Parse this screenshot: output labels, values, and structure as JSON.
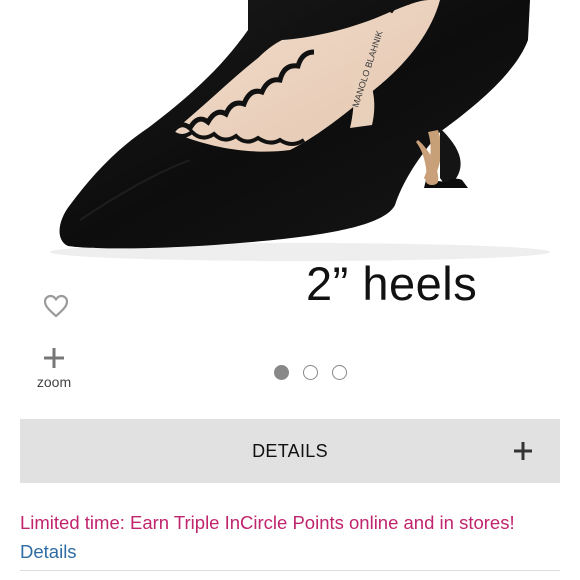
{
  "product": {
    "image_alt": "black suede scalloped kitten-heel pump",
    "overlay_caption": "2” heels"
  },
  "actions": {
    "favorite_icon": "heart-outline-icon",
    "zoom_icon": "plus-icon",
    "zoom_label": "zoom"
  },
  "carousel": {
    "total": 3,
    "active_index": 0
  },
  "details_section": {
    "label": "DETAILS",
    "expand_icon": "plus-icon"
  },
  "promo": {
    "text": "Limited time: Earn Triple InCircle Points online and in stores!",
    "link_label": "Details"
  },
  "colors": {
    "promo_text": "#c0246d",
    "link": "#2e6da4",
    "details_bar": "#e1e1e1",
    "dot_active": "#888888"
  }
}
